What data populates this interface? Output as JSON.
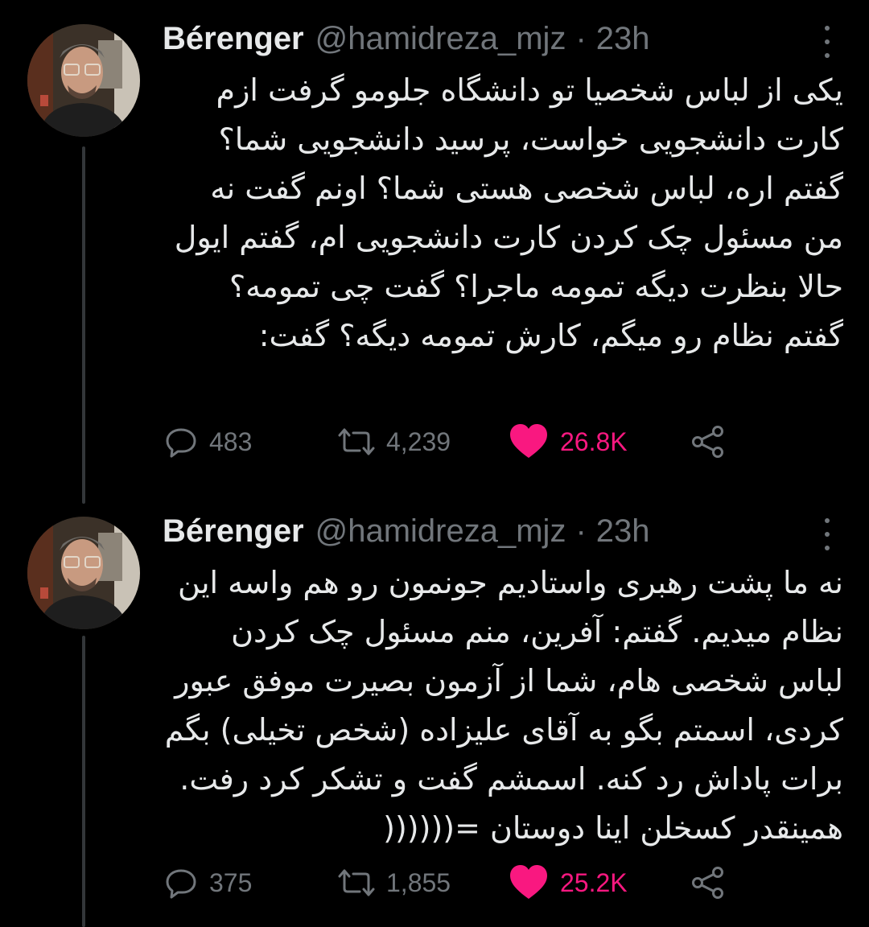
{
  "colors": {
    "background": "#000000",
    "text_primary": "#e7e9ea",
    "text_secondary": "#71767b",
    "like_pink": "#f91880",
    "thread_line": "#333639"
  },
  "icons": [
    "kebab-more-icon",
    "reply-icon",
    "retweet-icon",
    "heart-icon",
    "share-icon"
  ],
  "tweets": [
    {
      "author": {
        "display_name": "Bérenger",
        "handle": "@hamidreza_mjz",
        "separator": "·"
      },
      "time": "23h",
      "text": "یکی از لباس شخصیا تو دانشگاه جلومو گرفت ازم کارت دانشجویی خواست، پرسید دانشجویی شما؟ گفتم اره، لباس شخصی هستی شما؟ اونم گفت نه من مسئول چک کردن کارت دانشجویی ام، گفتم ایول حالا بنظرت دیگه تمومه ماجرا؟ گفت چی تمومه؟ گفتم نظام رو میگم، کارش تمومه دیگه؟ گفت:",
      "stats": {
        "replies": "483",
        "retweets": "4,239",
        "likes": "26.8K",
        "liked": true
      }
    },
    {
      "author": {
        "display_name": "Bérenger",
        "handle": "@hamidreza_mjz",
        "separator": "·"
      },
      "time": "23h",
      "text": "نه ما پشت رهبری واستادیم جونمون رو هم واسه این نظام میدیم. گفتم: آفرین، منم مسئول چک کردن لباس شخصی هام، شما از آزمون بصیرت موفق عبور کردی، اسمتم بگو به آقای علیزاده (شخص تخیلی) بگم برات پاداش رد کنه. اسمشم گفت و تشکر کرد رفت. همینقدر کسخلن اینا دوستان =((((((",
      "stats": {
        "replies": "375",
        "retweets": "1,855",
        "likes": "25.2K",
        "liked": true
      }
    }
  ]
}
